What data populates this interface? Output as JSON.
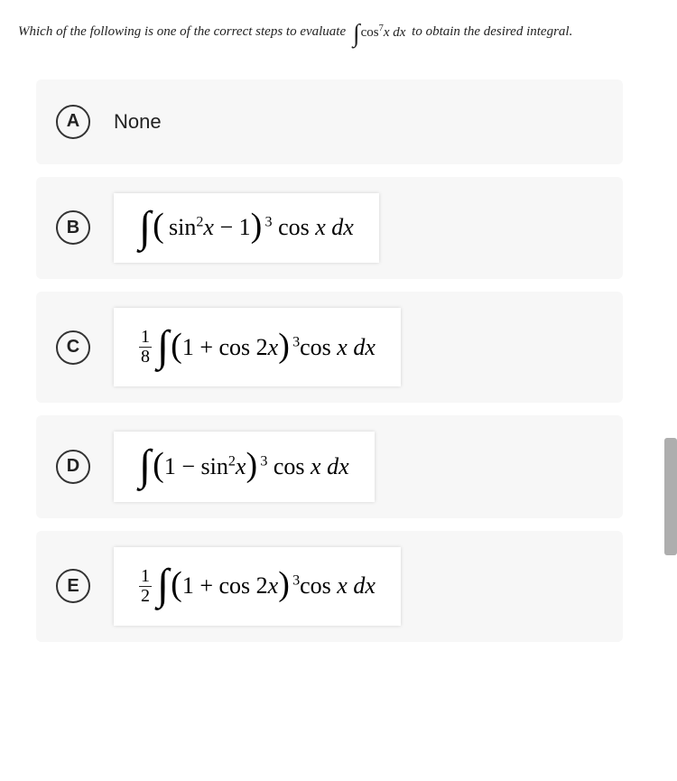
{
  "question": {
    "text_before": "Which of the following is one of the correct steps to evaluate ",
    "math_formula": "∫ cos⁷x dx",
    "text_after": " to obtain the desired integral."
  },
  "options": {
    "a": {
      "label": "A",
      "text": "None"
    },
    "b": {
      "label": "B",
      "formula": "∫ (sin²x − 1)³ cos x dx"
    },
    "c": {
      "label": "C",
      "frac_num": "1",
      "frac_den": "8",
      "formula": "∫ (1 + cos 2x)³cos x dx"
    },
    "d": {
      "label": "D",
      "formula": "∫ (1 − sin²x)³ cos x dx"
    },
    "e": {
      "label": "E",
      "frac_num": "1",
      "frac_den": "2",
      "formula": "∫ (1 + cos 2x)³cos x dx"
    }
  }
}
